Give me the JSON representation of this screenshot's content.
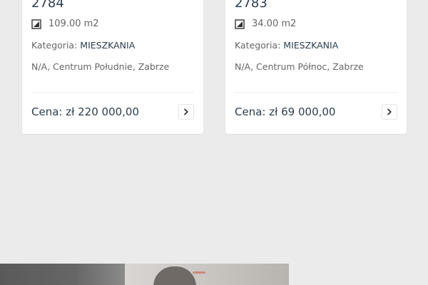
{
  "listings": [
    {
      "id": "2784",
      "area": "109.00 m2",
      "category_label": "Kategoria:",
      "category_value": "MIESZKANIA",
      "location": "N/A, Centrum Południe, Zabrze",
      "price": "Cena: zł 220 000,00"
    },
    {
      "id": "2783",
      "area": "34.00 m2",
      "category_label": "Kategoria:",
      "category_value": "MIESZKANIA",
      "location": "N/A, Centrum Północ, Zabrze",
      "price": "Cena: zł 69 000,00"
    }
  ],
  "icons": {
    "area": "area-icon",
    "arrow": "chevron-right-icon"
  },
  "colors": {
    "page_background": "#ebebeb",
    "card_background": "#ffffff",
    "title_text": "#2c3e50",
    "muted_text": "#666666"
  }
}
